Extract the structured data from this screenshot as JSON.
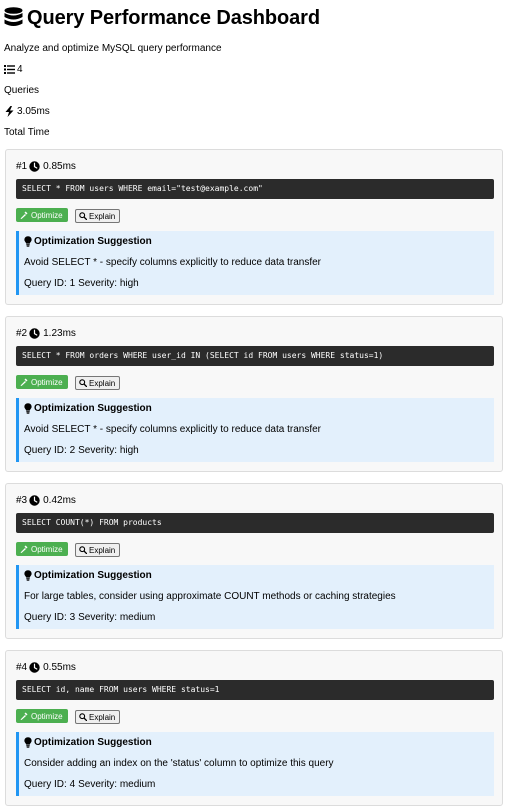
{
  "header": {
    "title": "Query Performance Dashboard",
    "subtitle": "Analyze and optimize MySQL query performance",
    "icon": "database-icon"
  },
  "stats": {
    "queries_value": "4",
    "queries_label": "Queries",
    "time_value": "3.05ms",
    "time_label": "Total Time"
  },
  "colors": {
    "optimize_button": "#4caf50",
    "suggestion_bg": "#e3f0fc",
    "suggestion_border": "#2196f3",
    "code_bg": "#2b2b2b"
  },
  "labels": {
    "optimize": "Optimize",
    "explain": "Explain",
    "suggestion_title": "Optimization Suggestion"
  },
  "queries": [
    {
      "number": "#1",
      "time": "0.85ms",
      "sql": "SELECT * FROM users WHERE email=\"test@example.com\"",
      "suggestion": "Avoid SELECT * - specify columns explicitly to reduce data transfer",
      "query_id": "Query ID: 1",
      "severity": "Severity: high"
    },
    {
      "number": "#2",
      "time": "1.23ms",
      "sql": "SELECT * FROM orders WHERE user_id IN (SELECT id FROM users WHERE status=1)",
      "suggestion": "Avoid SELECT * - specify columns explicitly to reduce data transfer",
      "query_id": "Query ID: 2",
      "severity": "Severity: high"
    },
    {
      "number": "#3",
      "time": "0.42ms",
      "sql": "SELECT COUNT(*) FROM products",
      "suggestion": "For large tables, consider using approximate COUNT methods or caching strategies",
      "query_id": "Query ID: 3",
      "severity": "Severity: medium"
    },
    {
      "number": "#4",
      "time": "0.55ms",
      "sql": "SELECT id, name FROM users WHERE status=1",
      "suggestion": "Consider adding an index on the 'status' column to optimize this query",
      "query_id": "Query ID: 4",
      "severity": "Severity: medium"
    }
  ]
}
